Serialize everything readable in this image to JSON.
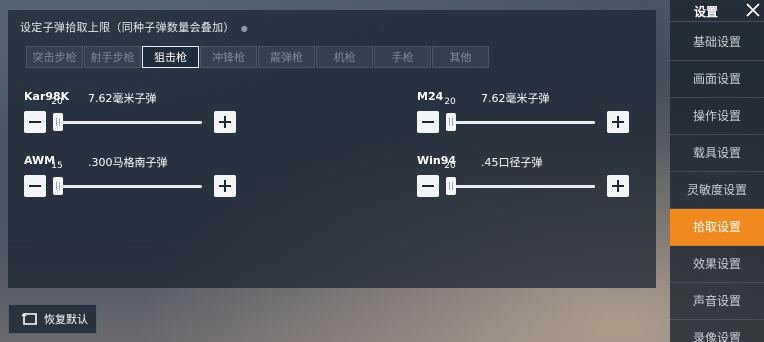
{
  "panel": {
    "title": "设定子弹拾取上限（同种子弹数量会叠加）",
    "hint_glyph": "●"
  },
  "tabs": [
    {
      "label": "突击步枪",
      "active": false
    },
    {
      "label": "射手步枪",
      "active": false
    },
    {
      "label": "狙击枪",
      "active": true
    },
    {
      "label": "冲锋枪",
      "active": false
    },
    {
      "label": "霰弹枪",
      "active": false
    },
    {
      "label": "机枪",
      "active": false
    },
    {
      "label": "手枪",
      "active": false
    },
    {
      "label": "其他",
      "active": false
    }
  ],
  "sliders": [
    {
      "gun": "Kar98K",
      "ammo": "7.62毫米子弹",
      "value": "20",
      "fraction": 0.0
    },
    {
      "gun": "M24",
      "ammo": "7.62毫米子弹",
      "value": "20",
      "fraction": 0.0
    },
    {
      "gun": "AWM",
      "ammo": ".300马格南子弹",
      "value": "15",
      "fraction": 0.0
    },
    {
      "gun": "Win94",
      "ammo": ".45口径子弹",
      "value": "20",
      "fraction": 0.0
    }
  ],
  "restore": {
    "label": "恢复默认"
  },
  "sidebar": {
    "title": "设置",
    "items": [
      {
        "label": "基础设置",
        "active": false
      },
      {
        "label": "画面设置",
        "active": false
      },
      {
        "label": "操作设置",
        "active": false
      },
      {
        "label": "载具设置",
        "active": false
      },
      {
        "label": "灵敏度设置",
        "active": false
      },
      {
        "label": "拾取设置",
        "active": true
      },
      {
        "label": "效果设置",
        "active": false
      },
      {
        "label": "声音设置",
        "active": false
      },
      {
        "label": "录像设置",
        "active": false
      }
    ]
  },
  "colors": {
    "accent": "#f08a1e",
    "panel_bg": "#1a2430",
    "text": "#ffffff"
  }
}
